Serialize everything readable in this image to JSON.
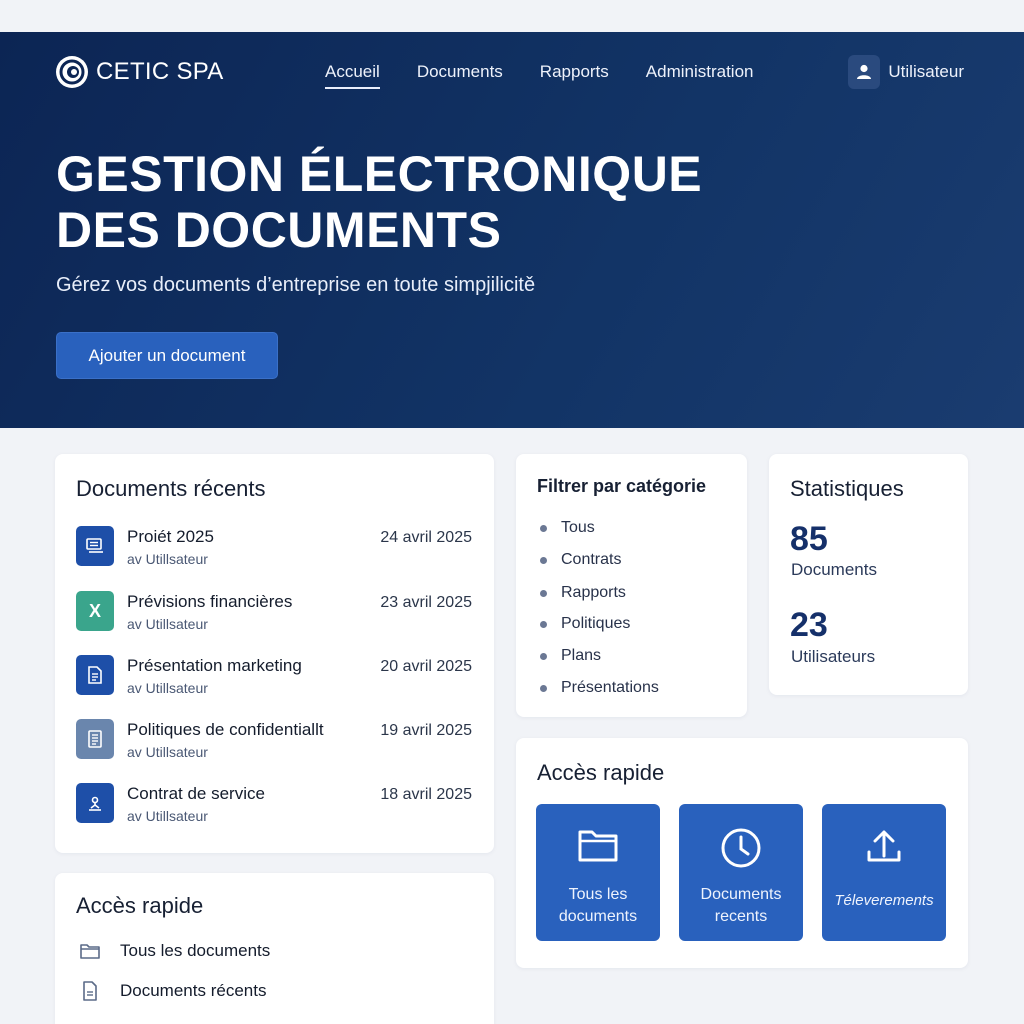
{
  "colors": {
    "hero_bg": "#0c2554",
    "accent": "#2961bd",
    "stat_number": "#15306a",
    "doc_icon_blue": "#1e4fa8",
    "doc_icon_green": "#3aa58c",
    "doc_icon_grey": "#6a86ad"
  },
  "header": {
    "brand": "CETIC SPA",
    "logo_icon": "c-ring-logo",
    "nav": [
      "Accueil",
      "Documents",
      "Rapports",
      "Administration"
    ],
    "active_nav": "Accueil",
    "user_icon": "user-icon",
    "user_label": "Utilisateur"
  },
  "hero": {
    "title_line1": "GESTION ÉLECTRONIQUE",
    "title_line2": "DES DOCUMENTS",
    "subtitle": "Gérez vos documents d’entreprise en toute simpjilicitě",
    "cta_label": "Ajouter un document"
  },
  "recent": {
    "title": "Documents récents",
    "items": [
      {
        "name": "Proiét 2025",
        "author": "av Utillsateur",
        "date": "24 avril 2025",
        "icon": "stack-document-icon"
      },
      {
        "name": "Prévisions financières",
        "author": "av Utillsateur",
        "date": "23 avril 2025",
        "icon": "excel-x-icon",
        "glyph": "X"
      },
      {
        "name": "Présentation marketing",
        "author": "av Utillsateur",
        "date": "20 avril 2025",
        "icon": "document-lines-icon"
      },
      {
        "name": "Politiques de confidentiallt",
        "author": "av Utillsateur",
        "date": "19 avril 2025",
        "icon": "policy-document-icon"
      },
      {
        "name": "Contrat de service",
        "author": "av Utillsateur",
        "date": "18 avril 2025",
        "icon": "signature-icon"
      }
    ]
  },
  "filter": {
    "title": "Filtrer par catégorie",
    "categories": [
      "Tous",
      "Contrats",
      "Rapports",
      "Politiques",
      "Plans",
      "Présentations"
    ]
  },
  "stats": {
    "title": "Statistiques",
    "documents_count": "85",
    "documents_label": "Documents",
    "users_count": "23",
    "users_label": "Utilisateurs"
  },
  "quick_tiles": {
    "title": "Accès rapide",
    "tiles": [
      {
        "label_line1": "Tous les",
        "label_line2": "documents",
        "icon": "folder-icon"
      },
      {
        "label_line1": "Documents",
        "label_line2": "recents",
        "icon": "clock-icon"
      },
      {
        "label_line1": "Téleverements",
        "label_line2": "",
        "icon": "upload-icon"
      }
    ]
  },
  "quick_list": {
    "title": "Accès rapide",
    "items": [
      {
        "label": "Tous les documents",
        "icon": "folder-icon"
      },
      {
        "label": "Documents récents",
        "icon": "document-icon"
      }
    ]
  }
}
